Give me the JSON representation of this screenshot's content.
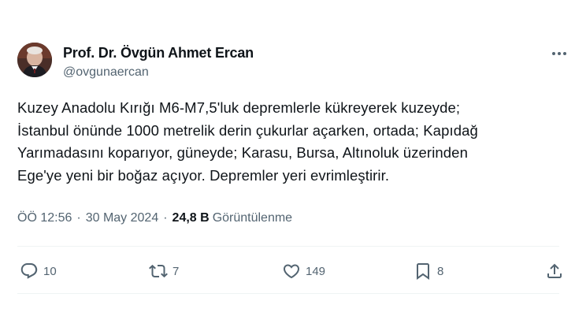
{
  "author": {
    "name": "Prof. Dr. Övgün Ahmet Ercan",
    "handle": "@ovgunaercan"
  },
  "tweet": {
    "text": "Kuzey Anadolu Kırığı M6-M7,5'luk depremlerle kükreyerek kuzeyde;\nİstanbul önünde 1000 metrelik derin çukurlar açarken, ortada; Kapıdağ\nYarımadasını koparıyor, güneyde; Karasu, Bursa, Altınoluk üzerinden\nEge'ye yeni bir boğaz açıyor. Depremler yeri evrimleştirir.",
    "time": "ÖÖ 12:56",
    "separator": "·",
    "date": "30 May 2024",
    "views_count": "24,8 B",
    "views_label": "Görüntülenme"
  },
  "actions": {
    "replies": "10",
    "reposts": "7",
    "likes": "149",
    "bookmarks": "8"
  },
  "icons": {
    "more": "more-horizontal-icon",
    "reply": "reply-icon",
    "repost": "repost-icon",
    "like": "heart-icon",
    "bookmark": "bookmark-icon",
    "share": "share-icon"
  },
  "colors": {
    "text": "#0f1419",
    "secondary": "#536471",
    "divider": "#eff3f4"
  }
}
